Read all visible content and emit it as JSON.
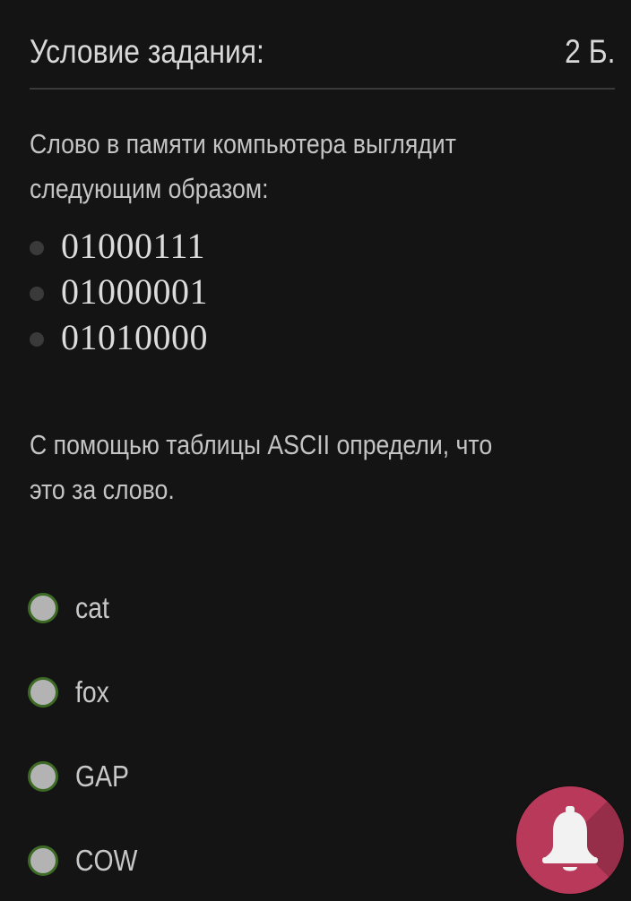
{
  "header": {
    "title": "Условие задания:",
    "points": "2 Б."
  },
  "question": {
    "intro": "Слово в памяти компьютера выглядит следующим образом:",
    "intro_line1": "Слово в памяти компьютера выглядит",
    "intro_line2": "следующим образом:",
    "bytes": [
      "01000111",
      "01000001",
      "01010000"
    ],
    "prompt_line1": "С помощью таблицы ASCII определи, что",
    "prompt_line2": "это за слово."
  },
  "answers": {
    "options": [
      {
        "label": "cat",
        "selected": false
      },
      {
        "label": "fox",
        "selected": false
      },
      {
        "label": "GAP",
        "selected": false
      },
      {
        "label": "COW",
        "selected": false
      }
    ]
  },
  "fab": {
    "icon": "bell-icon",
    "color": "#b8395a"
  },
  "colors": {
    "background": "#141414",
    "radio_border": "#3d6b25",
    "radio_fill": "#b3b3b3"
  }
}
